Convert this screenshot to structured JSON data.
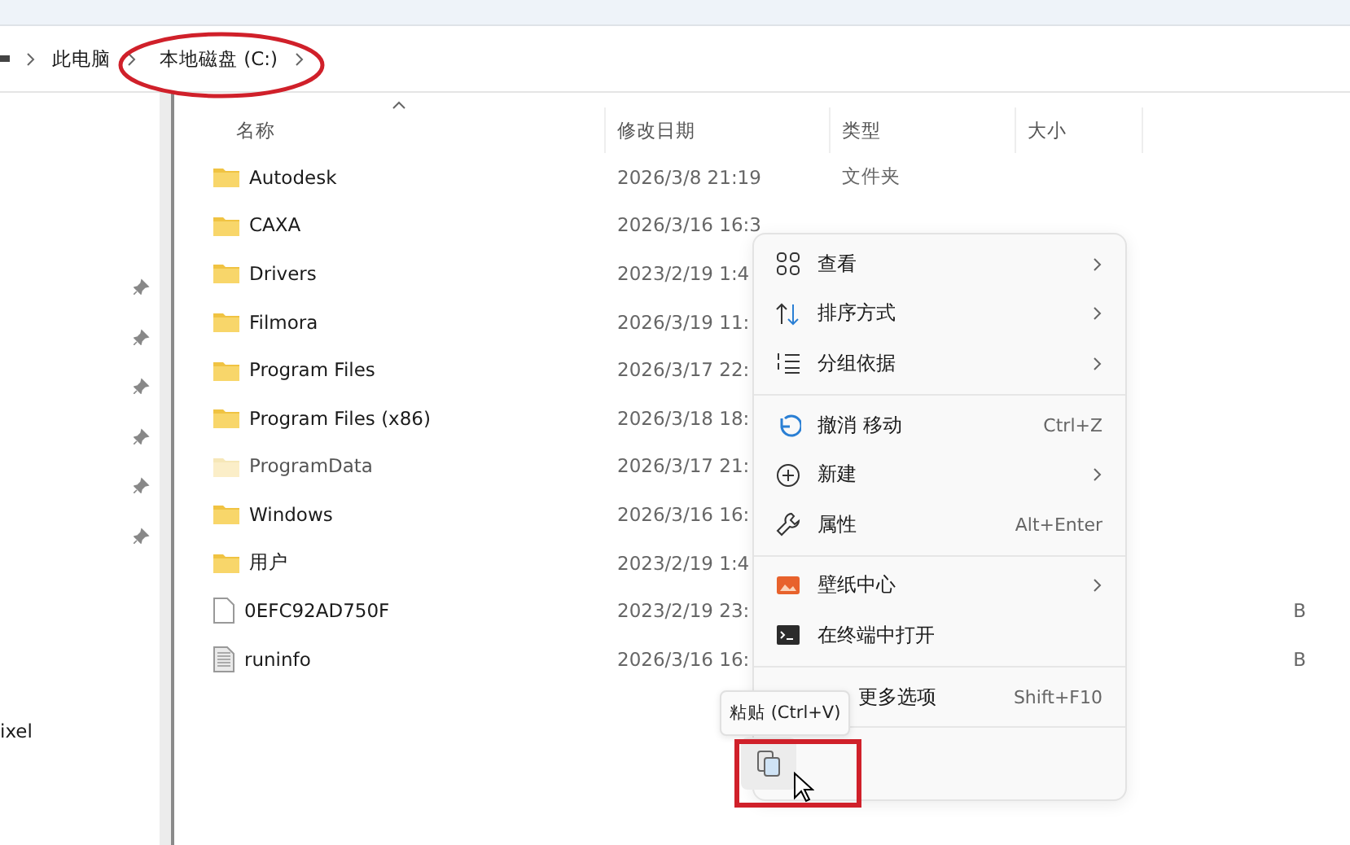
{
  "breadcrumb": [
    {
      "label": "此电脑"
    },
    {
      "label": "本地磁盘 (C:)"
    }
  ],
  "nav_items": [
    {
      "pinned": true
    },
    {
      "pinned": true
    },
    {
      "pinned": true
    },
    {
      "pinned": true
    },
    {
      "pinned": true
    },
    {
      "pinned": true
    },
    {
      "label": "ixel",
      "pinned": false
    }
  ],
  "table": {
    "columns": [
      {
        "label": "名称",
        "sorted": true
      },
      {
        "label": "修改日期",
        "sorted": false
      },
      {
        "label": "类型",
        "sorted": false
      },
      {
        "label": "大小",
        "sorted": false
      }
    ],
    "rows": [
      {
        "kind": "folder",
        "name": "Autodesk",
        "modified": "2026/3/8 21:19",
        "type": "文件夹",
        "hidden": false
      },
      {
        "kind": "folder",
        "name": "CAXA",
        "modified": "2026/3/16 16:3",
        "hidden": false
      },
      {
        "kind": "folder",
        "name": "Drivers",
        "modified": "2023/2/19 1:4",
        "hidden": false
      },
      {
        "kind": "folder",
        "name": "Filmora",
        "modified": "2026/3/19 11:",
        "hidden": false
      },
      {
        "kind": "folder",
        "name": "Program Files",
        "modified": "2026/3/17 22:",
        "hidden": false
      },
      {
        "kind": "folder",
        "name": "Program Files (x86)",
        "modified": "2026/3/18 18:",
        "hidden": false
      },
      {
        "kind": "folder",
        "name": "ProgramData",
        "modified": "2026/3/17 21:",
        "hidden": true
      },
      {
        "kind": "folder",
        "name": "Windows",
        "modified": "2026/3/16 16:",
        "hidden": false
      },
      {
        "kind": "folder",
        "name": "用户",
        "modified": "2023/2/19 1:4",
        "hidden": false
      },
      {
        "kind": "file",
        "name": "0EFC92AD750F",
        "modified": "2023/2/19 23:",
        "size": "B",
        "hidden": false
      },
      {
        "kind": "textfile",
        "name": "runinfo",
        "modified": "2026/3/16 16:",
        "size": "B",
        "hidden": false
      }
    ]
  },
  "context_menu": {
    "items": [
      {
        "kind": "item",
        "label": "查看",
        "submenu": true
      },
      {
        "kind": "item",
        "label": "排序方式",
        "submenu": true
      },
      {
        "kind": "item",
        "label": "分组依据",
        "submenu": true
      },
      {
        "kind": "separator"
      },
      {
        "kind": "item",
        "label": "撤消 移动",
        "shortcut": "Ctrl+Z",
        "submenu": false
      },
      {
        "kind": "item",
        "label": "新建",
        "submenu": true
      },
      {
        "kind": "item",
        "label": "属性",
        "shortcut": "Alt+Enter",
        "submenu": false
      },
      {
        "kind": "separator"
      },
      {
        "kind": "item",
        "label": "壁纸中心",
        "submenu": true
      },
      {
        "kind": "item",
        "label": "在终端中打开",
        "submenu": false
      },
      {
        "kind": "separator"
      },
      {
        "kind": "item",
        "label": "更多选项",
        "shortcut": "Shift+F10",
        "submenu": false
      },
      {
        "kind": "separator"
      },
      {
        "kind": "actions"
      }
    ]
  },
  "tooltip": "粘贴 (Ctrl+V)",
  "annotations": [
    {
      "kind": "ellipse"
    },
    {
      "kind": "rectangle"
    }
  ]
}
